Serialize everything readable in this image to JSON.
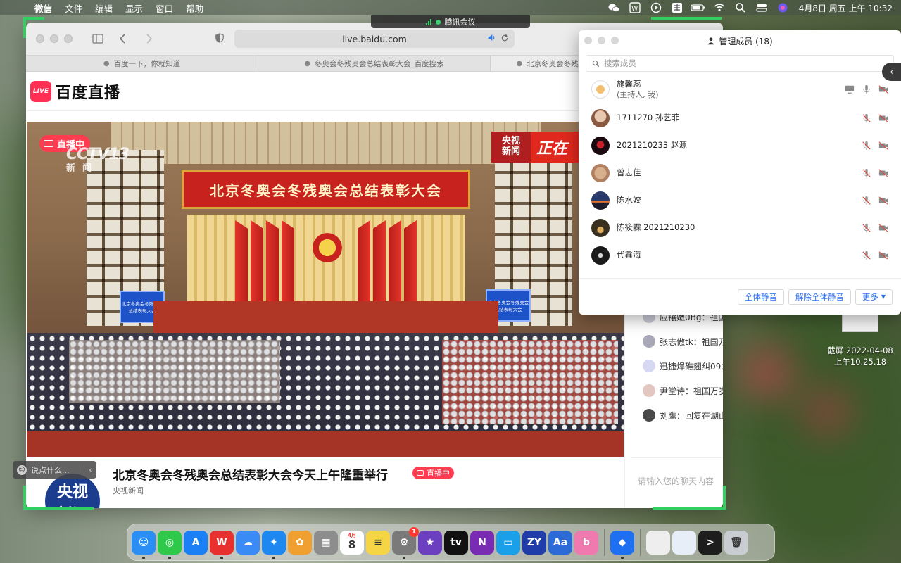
{
  "menubar": {
    "app_name": "微信",
    "menus": [
      "文件",
      "编辑",
      "显示",
      "窗口",
      "帮助"
    ],
    "clock": "4月8日 周五 上午 10:32"
  },
  "meeting_pill": {
    "label": "腾讯会议"
  },
  "browser": {
    "url": "live.baidu.com",
    "tabs": [
      {
        "label": "百度一下，你就知道"
      },
      {
        "label": "冬奥会冬残奥会总结表彰大会_百度搜索"
      },
      {
        "label": "北京冬奥会冬残奥会总结表彰大会今天上午隆重举行"
      }
    ],
    "brand": "百度直播",
    "logo_text": "LIVE"
  },
  "player": {
    "live_badge": "直播中",
    "cctv_logo": "CCTV13",
    "cctv_sub": "新闻",
    "corner_a_line1": "央视",
    "corner_a_line2": "新闻",
    "corner_b": "正在",
    "banner": "北京冬奥会冬残奥会总结表彰大会",
    "screen_text": "北京冬奥会冬残奥会总结表彰大会"
  },
  "video": {
    "title": "北京冬奥会冬残奥会总结表彰大会今天上午隆重举行",
    "live_tag": "直播中",
    "channel": "央视新闻",
    "avatar_line1": "央视",
    "avatar_line2": "新闻"
  },
  "chat": {
    "messages": [
      {
        "text": "应镶嫩0Bg：祖国"
      },
      {
        "text": "张志傲tk：祖国万"
      },
      {
        "text": "迅捷焊礁翘纠09："
      },
      {
        "text": "尹堂诗：祖国万岁"
      },
      {
        "text": "刘鹰：回复在湖山"
      }
    ],
    "input_placeholder": "请输入您的聊天内容"
  },
  "say_bubble": {
    "placeholder": "说点什么..."
  },
  "members_panel": {
    "title": "管理成员 (18)",
    "search_placeholder": "搜索成员",
    "members": [
      {
        "name": "施馨蕊",
        "sub": "(主持人, 我)"
      },
      {
        "name": "1711270 孙艺菲",
        "sub": ""
      },
      {
        "name": "2021210233 赵源",
        "sub": ""
      },
      {
        "name": "曾志佳",
        "sub": ""
      },
      {
        "name": "陈水姣",
        "sub": ""
      },
      {
        "name": "陈筱霖 2021210230",
        "sub": ""
      },
      {
        "name": "代鑫海",
        "sub": ""
      }
    ],
    "buttons": {
      "mute_all": "全体静音",
      "unmute_all": "解除全体静音",
      "more": "更多"
    }
  },
  "desktop_file": {
    "line1": "截屏 2022-04-08",
    "line2": "上午10.25.18"
  },
  "dock": {
    "items": [
      {
        "name": "finder-icon",
        "color": "#2b8ef5",
        "glyph": "☺"
      },
      {
        "name": "wechat-icon",
        "color": "#2ec84a",
        "glyph": "◎"
      },
      {
        "name": "app-store-icon",
        "color": "#1b7ff6",
        "glyph": "A"
      },
      {
        "name": "wps-icon",
        "color": "#e8312f",
        "glyph": "W"
      },
      {
        "name": "baidu-netdisk-icon",
        "color": "#3b8bf7",
        "glyph": "☁"
      },
      {
        "name": "safari-icon",
        "color": "#1e88f0",
        "glyph": "✦"
      },
      {
        "name": "photos-icon",
        "color": "#f0a030",
        "glyph": "✿"
      },
      {
        "name": "launchpad-icon",
        "color": "#8d8d8d",
        "glyph": "▦"
      },
      {
        "name": "calendar-icon",
        "color": "#ffffff",
        "glyph": "8"
      },
      {
        "name": "notes-icon",
        "color": "#f5d546",
        "glyph": "≡"
      },
      {
        "name": "system-preferences-icon",
        "color": "#7a7a7a",
        "glyph": "⚙"
      },
      {
        "name": "imovie-icon",
        "color": "#6b3fbf",
        "glyph": "★"
      },
      {
        "name": "apple-tv-icon",
        "color": "#111111",
        "glyph": "tv"
      },
      {
        "name": "onenote-icon",
        "color": "#7a2bb3",
        "glyph": "N"
      },
      {
        "name": "screenshot-tool-icon",
        "color": "#1aa0e8",
        "glyph": "▭"
      },
      {
        "name": "zy-icon",
        "color": "#1f3ca8",
        "glyph": "ZY"
      },
      {
        "name": "dictionary-icon",
        "color": "#2c6ad8",
        "glyph": "Aa"
      },
      {
        "name": "bilibili-icon",
        "color": "#f07ab0",
        "glyph": "b"
      },
      {
        "name": "tencent-meeting-icon",
        "color": "#1e6ff2",
        "glyph": "◆"
      },
      {
        "name": "recent-doc-1-icon",
        "color": "#eeeeee",
        "glyph": ""
      },
      {
        "name": "recent-doc-2-icon",
        "color": "#e8eef8",
        "glyph": ""
      },
      {
        "name": "terminal-icon",
        "color": "#1d1d1d",
        "glyph": ">"
      },
      {
        "name": "trash-icon",
        "color": "#c9ccd0",
        "glyph": "🗑"
      }
    ],
    "calendar_month": "4月",
    "badge_count": "1"
  },
  "colors": {
    "live_red": "#ff3b50",
    "tencent_blue": "#2a6ff0",
    "share_green": "#2fd060"
  }
}
